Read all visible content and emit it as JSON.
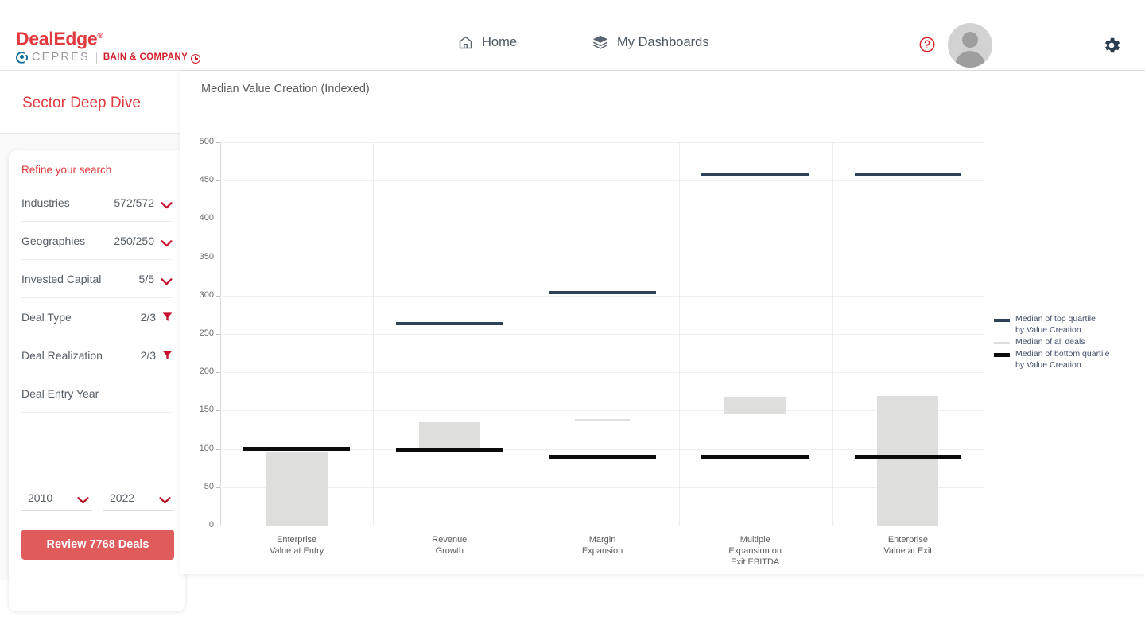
{
  "brand": {
    "product": "DealEdge",
    "registered": "®",
    "partner_left": "CEPRES",
    "partner_right": "BAIN & COMPANY"
  },
  "header": {
    "nav": [
      {
        "label": "Home",
        "icon": "home-icon"
      },
      {
        "label": "My Dashboards",
        "icon": "layers-icon"
      }
    ],
    "help_icon": "help-circle-icon",
    "avatar_icon": "user-avatar",
    "settings_icon": "gear-icon"
  },
  "sidebar": {
    "title": "Sector Deep Dive",
    "refine_label": "Refine your search",
    "filters": [
      {
        "label": "Industries",
        "count": "572/572",
        "control": "chevron-down-icon"
      },
      {
        "label": "Geographies",
        "count": "250/250",
        "control": "chevron-down-icon"
      },
      {
        "label": "Invested Capital",
        "count": "5/5",
        "control": "chevron-down-icon"
      },
      {
        "label": "Deal Type",
        "count": "2/3",
        "control": "funnel-icon"
      },
      {
        "label": "Deal Realization",
        "count": "2/3",
        "control": "funnel-icon"
      },
      {
        "label": "Deal Entry Year",
        "count": "",
        "control": "none"
      }
    ],
    "year_from": "2010",
    "year_to": "2022",
    "review_button": "Review 7768 Deals"
  },
  "chart_data": {
    "type": "bar",
    "title": "Median Value Creation (Indexed)",
    "xlabel": "",
    "ylabel": "",
    "ylim": [
      0,
      500
    ],
    "yticks": [
      0,
      50,
      100,
      150,
      200,
      250,
      300,
      350,
      400,
      450,
      500
    ],
    "grid": true,
    "legend_position": "right",
    "categories": [
      "Enterprise\nValue at Entry",
      "Revenue\nGrowth",
      "Margin\nExpansion",
      "Multiple\nExpansion on\nExit EBITDA",
      "Enterprise\nValue at Exit"
    ],
    "category_lines": [
      [
        "Enterprise",
        "Value at Entry"
      ],
      [
        "Revenue",
        "Growth"
      ],
      [
        "Margin",
        "Expansion"
      ],
      [
        "Multiple",
        "Expansion on",
        "Exit EBITDA"
      ],
      [
        "Enterprise",
        "Value at Exit"
      ]
    ],
    "bars": [
      {
        "category": "Enterprise Value at Entry",
        "bottom": 0,
        "top": 96
      },
      {
        "category": "Revenue Growth",
        "bottom": 100,
        "top": 135
      },
      {
        "category": "Margin Expansion",
        "bottom": null,
        "top": null
      },
      {
        "category": "Multiple Expansion on Exit EBITDA",
        "bottom": 145,
        "top": 168
      },
      {
        "category": "Enterprise Value at Exit",
        "bottom": 0,
        "top": 169
      }
    ],
    "series": [
      {
        "name": "Median of top quartile by Value Creation",
        "name_lines": [
          "Median of top quartile",
          "by Value Creation"
        ],
        "color": "#2b4257",
        "values": [
          null,
          263,
          304,
          458,
          458
        ]
      },
      {
        "name": "Median of all deals",
        "name_lines": [
          "Median of all deals"
        ],
        "color": "#dcdcdc",
        "values": [
          null,
          null,
          137,
          null,
          null
        ]
      },
      {
        "name": "Median of bottom quartile by Value Creation",
        "name_lines": [
          "Median of bottom quartile",
          "by Value Creation"
        ],
        "color": "#0b0b0b",
        "values": [
          101,
          100,
          90,
          90,
          90
        ]
      }
    ]
  },
  "colors": {
    "brand_red": "#e03a3e",
    "bain_red": "#cf2029",
    "navy": "#2b4257",
    "bar_gray": "#dededd"
  }
}
